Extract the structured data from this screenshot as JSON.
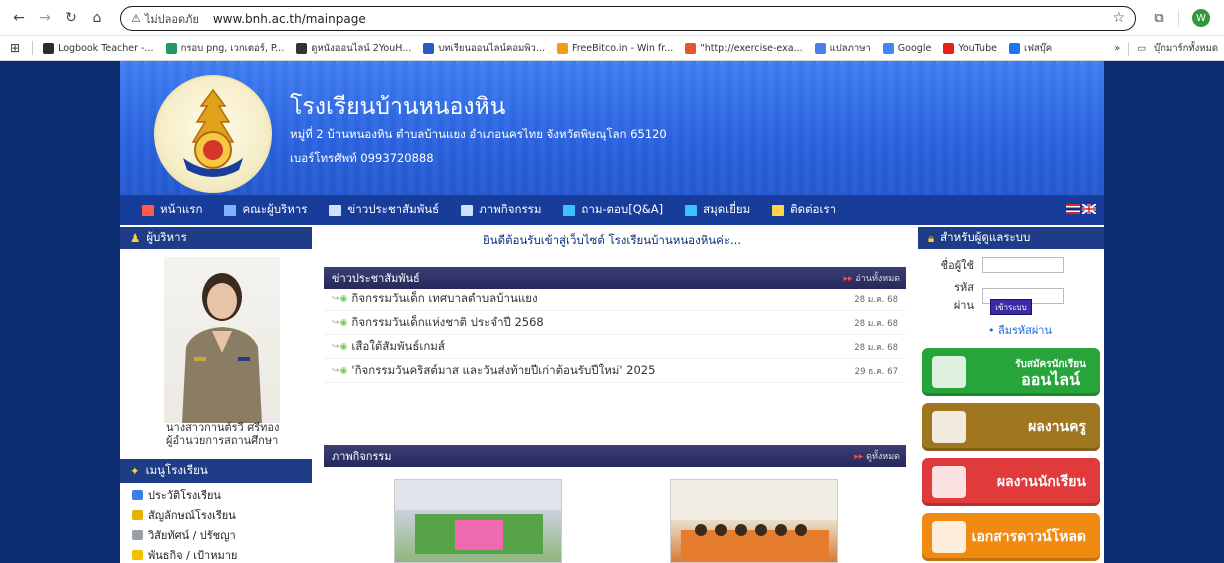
{
  "browser": {
    "url_warning": "ไม่ปลอดภัย",
    "url": "www.bnh.ac.th/mainpage",
    "profile_initial": "W"
  },
  "bookmarks": [
    {
      "label": "Logbook Teacher -...",
      "color": "#2c2c2c"
    },
    {
      "label": "กรอบ png, เวกเตอร์, P...",
      "color": "#1e9b63"
    },
    {
      "label": "ดูหนังออนไลน์ 2YouH...",
      "color": "#333333"
    },
    {
      "label": "บทเรียนออนไลน์คอมพิว...",
      "color": "#2a5bbf"
    },
    {
      "label": "FreeBitco.in - Win fr...",
      "color": "#f39c12"
    },
    {
      "label": "\"http://exercise-exa...",
      "color": "#e4572e"
    },
    {
      "label": "แปลภาษา",
      "color": "#4a7de8"
    },
    {
      "label": "Google",
      "color": "#4285f4"
    },
    {
      "label": "YouTube",
      "color": "#e62117"
    },
    {
      "label": "เฟสบุ๊ค",
      "color": "#1877f2"
    }
  ],
  "bookmarks_more": "»",
  "bookmarks_folder": "บุ๊กมาร์กทั้งหมด",
  "site": {
    "title": "โรงเรียนบ้านหนองหิน",
    "address": "หมู่ที่ 2 บ้านหนองหิน ตำบลบ้านแยง อำเภอนครไทย จังหวัดพิษณุโลก 65120",
    "phone": "เบอร์โทรศัพท์ 0993720888"
  },
  "menu": [
    {
      "label": "หน้าแรก",
      "color": "#ff5a4a"
    },
    {
      "label": "คณะผู้บริหาร",
      "color": "#7fb3ff"
    },
    {
      "label": "ข่าวประชาสัมพันธ์",
      "color": "#cfe0ff"
    },
    {
      "label": "ภาพกิจกรรม",
      "color": "#cfe0ff"
    },
    {
      "label": "ถาม-ตอบ[Q&A]",
      "color": "#39c2ff"
    },
    {
      "label": "สมุดเยี่ยม",
      "color": "#39c2ff"
    },
    {
      "label": "ติดต่อเรา",
      "color": "#ffd34a"
    }
  ],
  "left": {
    "admin_head": "ผู้บริหาร",
    "admin_name": "นางสาวกานต์รวี ศรีทอง",
    "admin_position": "ผู้อำนวยการสถานศึกษา",
    "menu_head": "เมนูโรงเรียน",
    "menu_items": [
      {
        "label": "ประวัติโรงเรียน",
        "color": "#3b7fe0"
      },
      {
        "label": "สัญลักษณ์โรงเรียน",
        "color": "#e8b000"
      },
      {
        "label": "วิสัยทัศน์ / ปรัชญา",
        "color": "#9aa0a8"
      },
      {
        "label": "พันธกิจ / เป้าหมาย",
        "color": "#f2c200"
      }
    ]
  },
  "center": {
    "welcome": "ยินดีต้อนรับเข้าสู่เว็บไซต์ โรงเรียนบ้านหนองหินค่ะ...",
    "news_head": "ข่าวประชาสัมพันธ์",
    "news_more": "อ่านทั้งหมด",
    "news": [
      {
        "title": "กิจกรรมวันเด็ก เทศบาลตำบลบ้านแยง",
        "date": "28 ม.ค. 68"
      },
      {
        "title": "กิจกรรมวันเด็กแห่งชาติ ประจำปี 2568",
        "date": "28 ม.ค. 68"
      },
      {
        "title": "เสือใต้สัมพันธ์เกมส์",
        "date": "28 ม.ค. 68"
      },
      {
        "title": "'กิจกรรมวันคริสต์มาส และวันส่งท้ายปีเก่าต้อนรับปีใหม่' 2025",
        "date": "29 ธ.ค. 67"
      }
    ],
    "photo_head": "ภาพกิจกรรม",
    "photo_more": "ดูทั้งหมด"
  },
  "right": {
    "login_head": "สำหรับผู้ดูแลระบบ",
    "username_label": "ชื่อผู้ใช้",
    "password_label": "รหัสผ่าน",
    "login_button": "เข้าระบบ",
    "forgot": "• ลืมรหัสผ่าน",
    "promos": [
      {
        "title": "รับสมัครนักเรียน",
        "sub": "ออนไลน์",
        "bg": "#27a43a"
      },
      {
        "title": "ผลงานครู",
        "sub": "",
        "bg": "#a07620"
      },
      {
        "title": "ผลงานนักเรียน",
        "sub": "",
        "bg": "#e03a3a"
      },
      {
        "title": "เอกสารดาวน์โหลด",
        "sub": "",
        "bg": "#f08a10"
      }
    ]
  }
}
